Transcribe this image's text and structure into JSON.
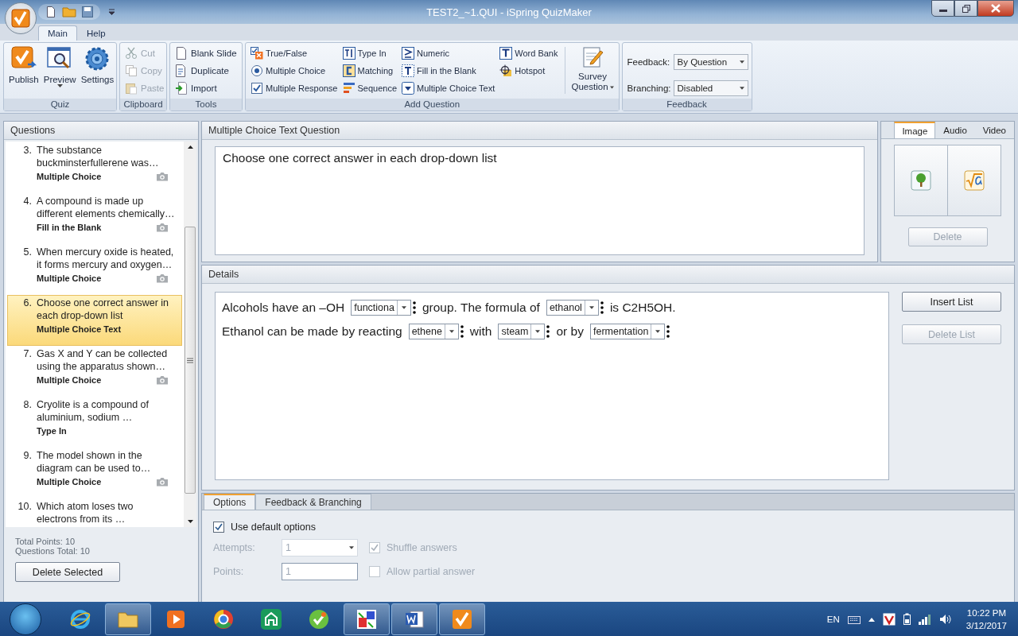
{
  "window": {
    "title": "TEST2_~1.QUI - iSpring QuizMaker"
  },
  "ribbon": {
    "tabs": [
      {
        "label": "Main",
        "selected": true
      },
      {
        "label": "Help",
        "selected": false
      }
    ],
    "quiz": {
      "label": "Quiz",
      "buttons": [
        {
          "label": "Publish"
        },
        {
          "label": "Preview",
          "dropdown": true
        },
        {
          "label": "Settings"
        }
      ]
    },
    "clipboard": {
      "label": "Clipboard",
      "items": [
        {
          "label": "Cut",
          "disabled": true
        },
        {
          "label": "Copy",
          "disabled": true
        },
        {
          "label": "Paste",
          "disabled": true
        }
      ]
    },
    "tools": {
      "label": "Tools",
      "items": [
        {
          "label": "Blank Slide"
        },
        {
          "label": "Duplicate"
        },
        {
          "label": "Import"
        }
      ]
    },
    "add_question": {
      "label": "Add Question",
      "items": [
        {
          "label": "True/False"
        },
        {
          "label": "Multiple Choice"
        },
        {
          "label": "Multiple Response"
        },
        {
          "label": "Type In"
        },
        {
          "label": "Matching"
        },
        {
          "label": "Sequence"
        },
        {
          "label": "Numeric"
        },
        {
          "label": "Fill in the Blank"
        },
        {
          "label": "Multiple Choice Text"
        },
        {
          "label": "Word Bank"
        },
        {
          "label": "Hotspot"
        }
      ],
      "survey": {
        "label_lines": [
          "Survey",
          "Question"
        ]
      }
    },
    "feedback": {
      "label": "Feedback",
      "fields": [
        {
          "label": "Feedback:",
          "value": "By Question"
        },
        {
          "label": "Branching:",
          "value": "Disabled"
        }
      ]
    }
  },
  "questions": {
    "title": "Questions",
    "items": [
      {
        "number": "3.",
        "text": "The substance buckminsterfullerene was…",
        "type": "Multiple Choice",
        "image": true,
        "selected": false
      },
      {
        "number": "4.",
        "text": "A compound is made up different elements chemically…",
        "type": "Fill in the Blank",
        "image": true,
        "selected": false
      },
      {
        "number": "5.",
        "text": "When mercury oxide is heated, it forms mercury and oxygen…",
        "type": "Multiple Choice",
        "image": true,
        "selected": false
      },
      {
        "number": "6.",
        "text": "Choose one correct answer in each drop-down list",
        "type": "Multiple Choice Text",
        "image": false,
        "selected": true
      },
      {
        "number": "7.",
        "text": "Gas X and Y can be collected using the apparatus shown…",
        "type": "Multiple Choice",
        "image": true,
        "selected": false
      },
      {
        "number": "8.",
        "text": "Cryolite is a compound of aluminium, sodium …",
        "type": "Type In",
        "image": false,
        "selected": false
      },
      {
        "number": "9.",
        "text": "The model shown in the diagram can be used to…",
        "type": "Multiple Choice",
        "image": true,
        "selected": false
      },
      {
        "number": "10.",
        "text": "Which atom loses two electrons from its …",
        "image": false,
        "selected": false
      }
    ],
    "total_points": "Total Points: 10",
    "questions_total": "Questions Total: 10",
    "delete_button": "Delete Selected"
  },
  "question": {
    "title": "Multiple Choice Text Question",
    "text": "Choose one correct answer in each drop-down list"
  },
  "media": {
    "tabs": [
      {
        "label": "Image",
        "selected": true
      },
      {
        "label": "Audio",
        "selected": false
      },
      {
        "label": "Video",
        "selected": false
      }
    ],
    "delete_button": {
      "label": "Delete",
      "disabled": true
    }
  },
  "details": {
    "title": "Details",
    "lines": [
      [
        {
          "kind": "text",
          "text": "Alcohols have an –OH"
        },
        {
          "kind": "dropdown",
          "value": "functiona"
        },
        {
          "kind": "text",
          "text": "group.  The formula of"
        },
        {
          "kind": "dropdown",
          "value": "ethanol"
        },
        {
          "kind": "text",
          "text": "is C2H5OH."
        }
      ],
      [
        {
          "kind": "text",
          "text": "Ethanol can be made by reacting"
        },
        {
          "kind": "dropdown",
          "value": "ethene"
        },
        {
          "kind": "text",
          "text": "with"
        },
        {
          "kind": "dropdown",
          "value": "steam"
        },
        {
          "kind": "text",
          "text": "or by"
        },
        {
          "kind": "dropdown",
          "value": "fermentation"
        }
      ]
    ],
    "insert_button": {
      "label": "Insert List",
      "disabled": false
    },
    "delete_button": {
      "label": "Delete List",
      "disabled": true
    }
  },
  "options": {
    "tabs": [
      {
        "label": "Options",
        "selected": true
      },
      {
        "label": "Feedback & Branching",
        "selected": false
      }
    ],
    "use_default": {
      "label": "Use default options",
      "checked": true
    },
    "attempts": {
      "label": "Attempts:",
      "value": "1",
      "disabled": true
    },
    "shuffle": {
      "label": "Shuffle answers",
      "checked": true,
      "disabled": true
    },
    "points": {
      "label": "Points:",
      "value": "1",
      "disabled": true
    },
    "partial": {
      "label": "Allow partial answer",
      "checked": false,
      "disabled": true
    }
  },
  "taskbar": {
    "language": "EN",
    "time": "10:22 PM",
    "date": "3/12/2017"
  }
}
